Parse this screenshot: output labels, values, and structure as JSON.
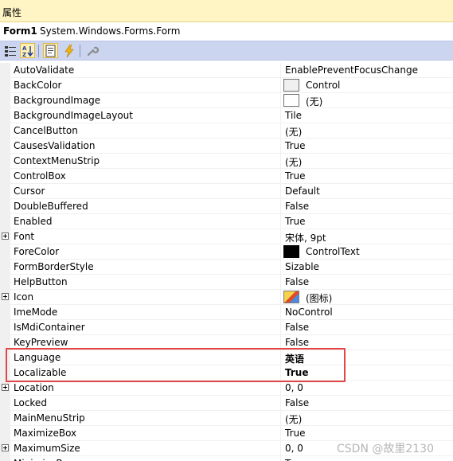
{
  "panel": {
    "title": "属性",
    "object_name": "Form1",
    "object_type": "System.Windows.Forms.Form"
  },
  "toolbar": {
    "buttons": [
      {
        "icon": "categorized-icon",
        "active": false
      },
      {
        "icon": "alphabetical-sort-icon",
        "active": true
      },
      {
        "icon": "properties-icon",
        "active": true
      },
      {
        "icon": "events-lightning-icon",
        "active": false
      },
      {
        "icon": "property-pages-wrench-icon",
        "active": false
      }
    ]
  },
  "properties": [
    {
      "name": "AutoValidate",
      "value": "EnablePreventFocusChange"
    },
    {
      "name": "BackColor",
      "value": "Control",
      "swatch": "#f0f0f0"
    },
    {
      "name": "BackgroundImage",
      "value": "(无)",
      "swatch": "#ffffff"
    },
    {
      "name": "BackgroundImageLayout",
      "value": "Tile"
    },
    {
      "name": "CancelButton",
      "value": "(无)"
    },
    {
      "name": "CausesValidation",
      "value": "True"
    },
    {
      "name": "ContextMenuStrip",
      "value": "(无)"
    },
    {
      "name": "ControlBox",
      "value": "True"
    },
    {
      "name": "Cursor",
      "value": "Default"
    },
    {
      "name": "DoubleBuffered",
      "value": "False"
    },
    {
      "name": "Enabled",
      "value": "True"
    },
    {
      "name": "Font",
      "value": "宋体, 9pt",
      "expandable": true
    },
    {
      "name": "ForeColor",
      "value": "ControlText",
      "swatch": "#000000"
    },
    {
      "name": "FormBorderStyle",
      "value": "Sizable"
    },
    {
      "name": "HelpButton",
      "value": "False"
    },
    {
      "name": "Icon",
      "value": "(图标)",
      "expandable": true,
      "swatch": "icon-image"
    },
    {
      "name": "ImeMode",
      "value": "NoControl"
    },
    {
      "name": "IsMdiContainer",
      "value": "False"
    },
    {
      "name": "KeyPreview",
      "value": "False"
    },
    {
      "name": "Language",
      "value": "英语",
      "bold": true
    },
    {
      "name": "Localizable",
      "value": "True",
      "bold": true
    },
    {
      "name": "Location",
      "value": "0, 0",
      "expandable": true
    },
    {
      "name": "Locked",
      "value": "False"
    },
    {
      "name": "MainMenuStrip",
      "value": "(无)"
    },
    {
      "name": "MaximizeBox",
      "value": "True"
    },
    {
      "name": "MaximumSize",
      "value": "0, 0",
      "expandable": true
    },
    {
      "name": "MinimizeBox",
      "value": "True"
    }
  ],
  "watermark": "CSDN @故里2130",
  "colors": {
    "title_bg": "#fff5c4",
    "toolbar_bg": "#ccd5f0",
    "highlight_border": "#e24646"
  }
}
